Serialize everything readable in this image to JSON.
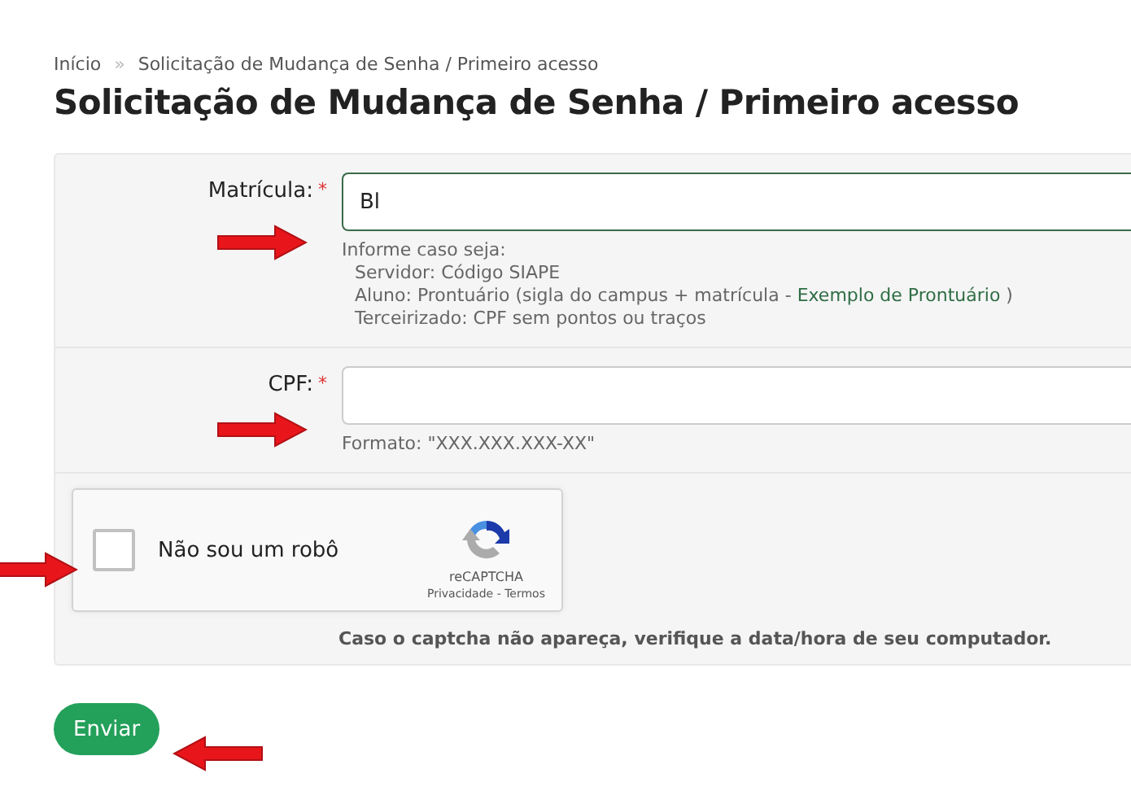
{
  "breadcrumb": {
    "separator": "»",
    "items": [
      {
        "label": "Início"
      },
      {
        "label": "Solicitação de Mudança de Senha / Primeiro acesso"
      }
    ]
  },
  "title": "Solicitação de Mudança de Senha / Primeiro acesso",
  "fields": [
    {
      "label": "Matrícula:",
      "required_mark": "*",
      "value": "Bl",
      "focused": true,
      "help": [
        {
          "kind": "heading",
          "text": "Informe caso seja:"
        },
        {
          "kind": "item",
          "text": "Servidor: Código SIAPE"
        },
        {
          "kind": "item",
          "text": "Aluno: Prontuário (sigla do campus + matrícula - ",
          "link": "Exemplo de Prontuário",
          "after": " )"
        },
        {
          "kind": "item",
          "text": "Terceirizado: CPF sem pontos ou traços"
        }
      ]
    },
    {
      "label": "CPF:",
      "required_mark": "*",
      "focused": false,
      "help": [
        {
          "kind": "heading",
          "text": "Formato: \"XXX.XXX.XXX-XX\""
        }
      ]
    }
  ],
  "captcha": {
    "label": "Não sou um robô",
    "checked": false,
    "brand": "reCAPTCHA",
    "links": [
      "Privacidade",
      "Termos"
    ],
    "link_separator": " - ",
    "note": "Caso o captcha não apareça, verifique a data/hora de seu computador."
  },
  "submit": "Enviar"
}
